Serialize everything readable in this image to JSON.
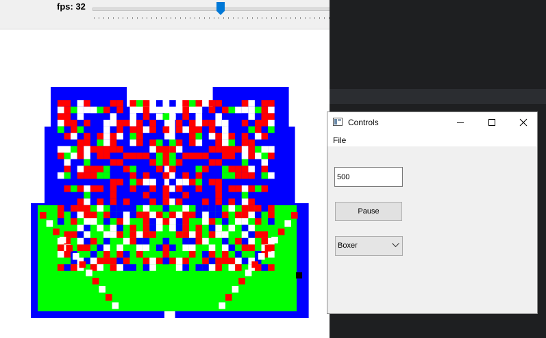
{
  "viewer": {
    "fps_label": "fps: 32",
    "fps_value": 32,
    "slider_fraction": 0.54
  },
  "controls": {
    "title": "Controls",
    "menu": {
      "file": "File"
    },
    "value_input": "500",
    "pause_label": "Pause",
    "mode_selected": "Boxer"
  },
  "colors": {
    "red": "#ff0000",
    "green": "#00ff00",
    "blue": "#0000ff",
    "white": "#ffffff",
    "black": "#000000",
    "accent": "#0078d7"
  },
  "icons": [
    "app-icon",
    "minimize-icon",
    "maximize-icon",
    "close-icon",
    "chevron-down-icon",
    "slider-thumb-icon"
  ]
}
